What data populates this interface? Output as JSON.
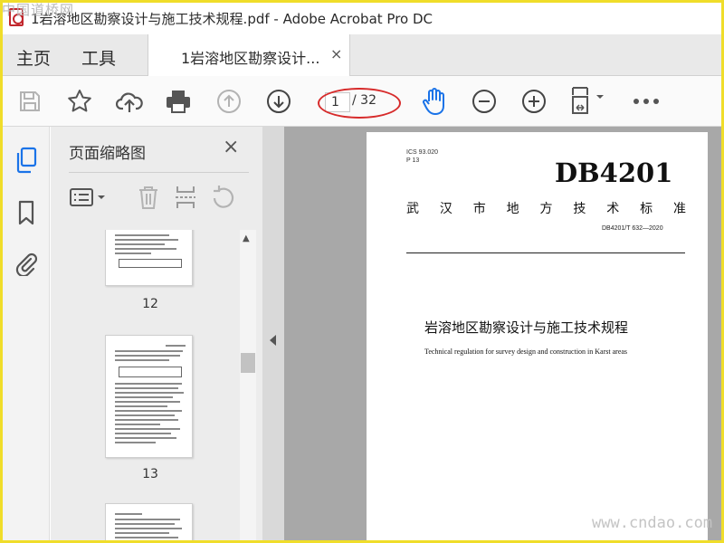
{
  "window": {
    "title": "1岩溶地区勘察设计与施工技术规程.pdf - Adobe Acrobat Pro DC",
    "watermark": "中国道桥网"
  },
  "tabs": {
    "home": "主页",
    "tools": "工具",
    "document": "1岩溶地区勘察设计...",
    "close": "×"
  },
  "toolbar": {
    "current_page": "1",
    "total_pages": "/ 32",
    "icons": [
      "save-icon",
      "star-icon",
      "upload-cloud-icon",
      "print-icon",
      "page-up-icon",
      "page-down-icon",
      "hand-icon",
      "zoom-out-icon",
      "zoom-in-icon",
      "fit-page-icon",
      "more-icon"
    ],
    "accent_color": "#1a73e8",
    "annotation_color": "#d72b2b"
  },
  "sidebar": {
    "panel_title": "页面缩略图",
    "close": "×",
    "thumbnails": [
      {
        "page": "12"
      },
      {
        "page": "13"
      }
    ]
  },
  "document": {
    "ics": "ICS 93.020",
    "ccs": "P 13",
    "code": "DB4201",
    "category": [
      "武",
      "汉",
      "市",
      "地",
      "方",
      "技",
      "术",
      "标",
      "准"
    ],
    "standard_no": "DB4201/T 632—2020",
    "title_cn": "岩溶地区勘察设计与施工技术规程",
    "title_en": "Technical regulation for survey design and construction in Karst areas"
  },
  "footer_watermark": "www.cndao.com"
}
